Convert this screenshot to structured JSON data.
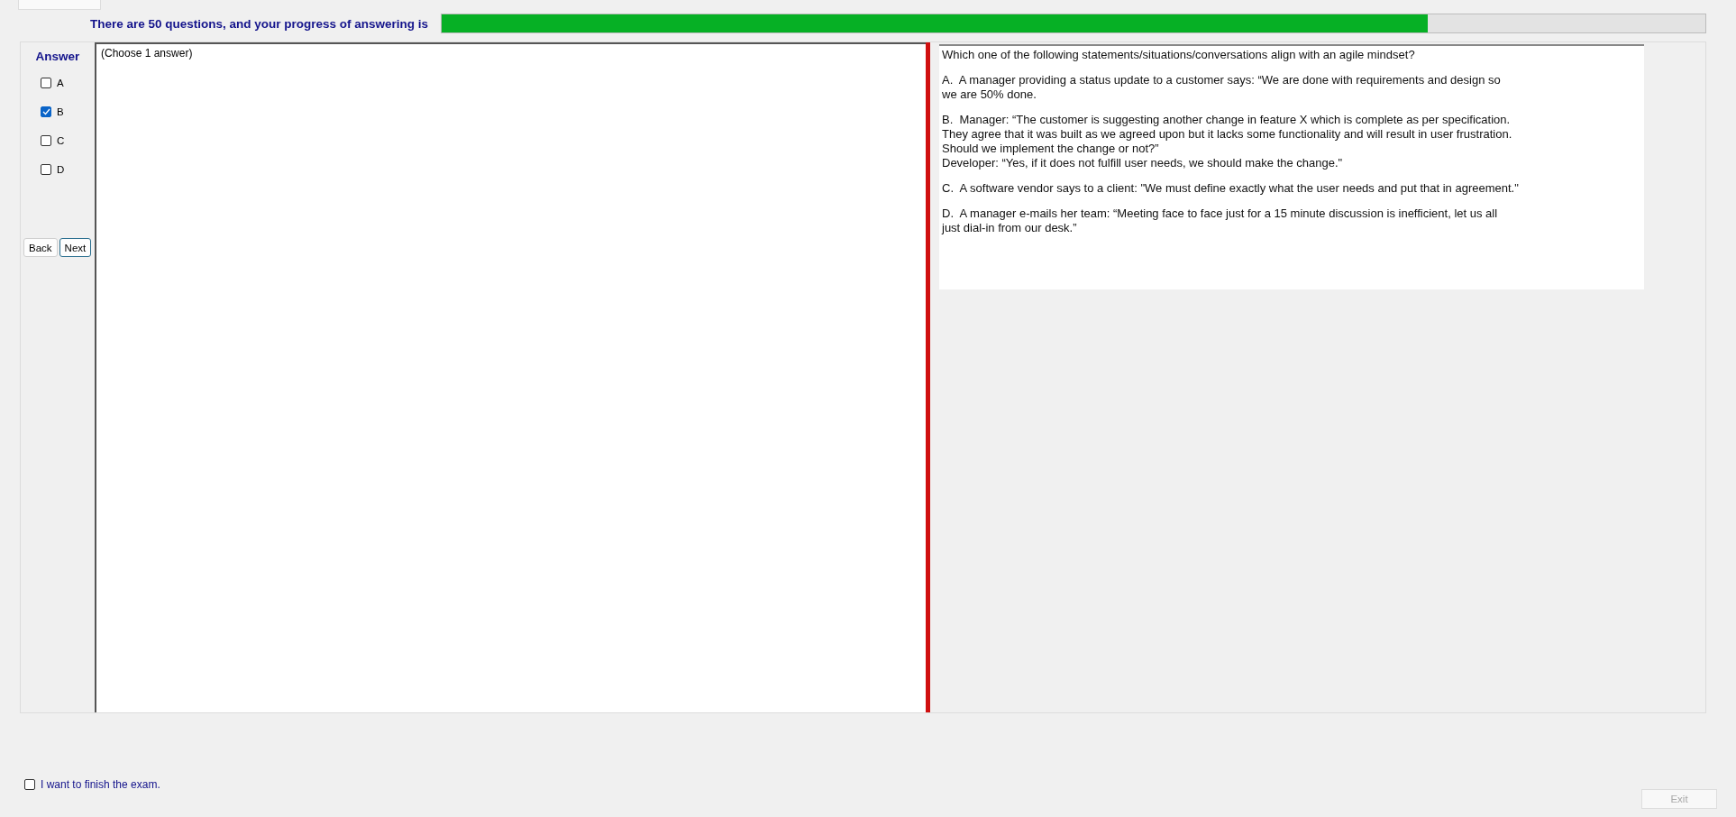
{
  "header": {
    "progress_text": "There are 50 questions, and your progress of answering is",
    "progress": {
      "level": 0.78
    }
  },
  "answer_panel": {
    "title": "Answer",
    "options": [
      {
        "label": "A",
        "checked": false
      },
      {
        "label": "B",
        "checked": true
      },
      {
        "label": "C",
        "checked": false
      },
      {
        "label": "D",
        "checked": false
      }
    ],
    "buttons": [
      {
        "label": "Back",
        "focused": false
      },
      {
        "label": "Next",
        "focused": true
      }
    ]
  },
  "instruction": "(Choose 1 answer)",
  "question": {
    "paragraphs": [
      "Which one of the following statements/situations/conversations align with an agile mindset?",
      "A.  A manager providing a status update to a customer says: “We are done with requirements and design so\nwe are 50% done.",
      "B.  Manager: “The customer is suggesting another change in feature X which is complete as per specification.\nThey agree that it was built as we agreed upon but it lacks some functionality and will result in user frustration.\nShould we implement the change or not?”\nDeveloper: “Yes, if it does not fulfill user needs, we should make the change.\"",
      "C.  A software vendor says to a client: \"We must define exactly what the user needs and put that in agreement.\"",
      "D.  A manager e-mails her team: “Meeting face to face just for a 15 minute discussion is inefficient, let us all\njust dial-in from our desk.”"
    ]
  },
  "finish": {
    "label": "I want to finish the exam.",
    "checked": false
  },
  "exit_button": {
    "label": "Exit",
    "disabled": true
  }
}
